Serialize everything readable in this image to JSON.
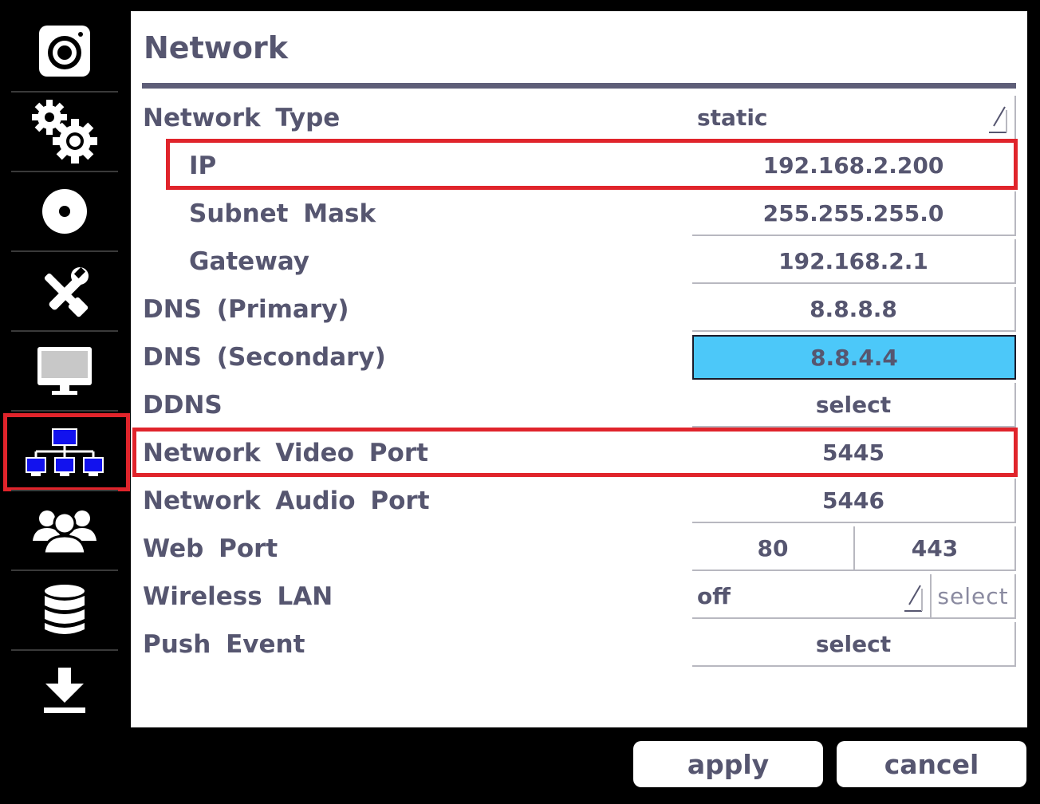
{
  "sidebar": {
    "items": [
      {
        "icon": "camera-icon"
      },
      {
        "icon": "gears-icon"
      },
      {
        "icon": "disc-icon"
      },
      {
        "icon": "tools-icon"
      },
      {
        "icon": "monitor-icon"
      },
      {
        "icon": "network-icon",
        "selected": true
      },
      {
        "icon": "users-icon"
      },
      {
        "icon": "database-icon"
      },
      {
        "icon": "download-icon"
      }
    ]
  },
  "panel": {
    "title": "Network",
    "rows": {
      "network_type": {
        "label": "Network Type",
        "value": "static"
      },
      "ip": {
        "label": "IP",
        "value": "192.168.2.200"
      },
      "subnet_mask": {
        "label": "Subnet Mask",
        "value": "255.255.255.0"
      },
      "gateway": {
        "label": "Gateway",
        "value": "192.168.2.1"
      },
      "dns_primary": {
        "label": "DNS (Primary)",
        "value": "8.8.8.8"
      },
      "dns_secondary": {
        "label": "DNS (Secondary)",
        "value": "8.8.4.4"
      },
      "ddns": {
        "label": "DDNS",
        "value": "select"
      },
      "video_port": {
        "label": "Network Video Port",
        "value": "5445"
      },
      "audio_port": {
        "label": "Network Audio Port",
        "value": "5446"
      },
      "web_port": {
        "label": "Web Port",
        "http": "80",
        "https": "443"
      },
      "wireless_lan": {
        "label": "Wireless LAN",
        "value": "off",
        "action": "select"
      },
      "push_event": {
        "label": "Push Event",
        "value": "select"
      }
    }
  },
  "buttons": {
    "apply": "apply",
    "cancel": "cancel"
  },
  "colors": {
    "accent": "#4cc8f9",
    "highlight": "#e0242b",
    "text": "#565670",
    "network_icon": "#1212ee"
  }
}
